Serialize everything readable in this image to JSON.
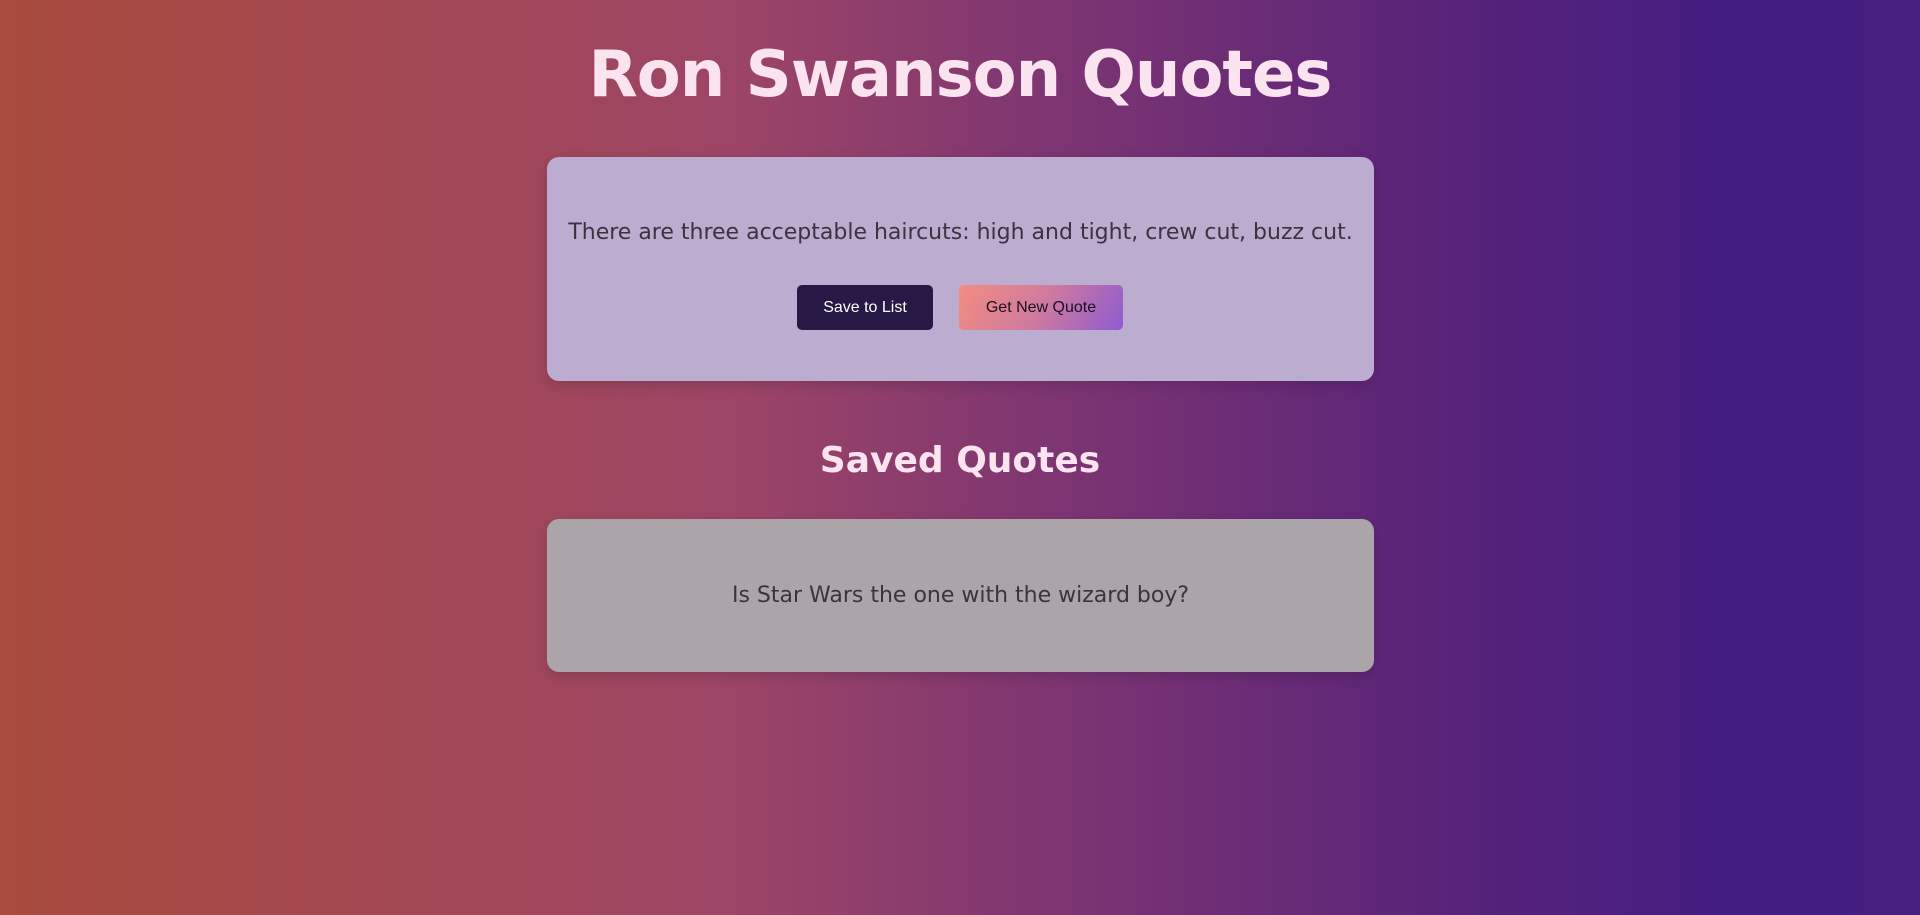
{
  "header": {
    "title": "Ron Swanson Quotes"
  },
  "current_quote": {
    "text": "There are three acceptable haircuts: high and tight, crew cut, buzz cut.",
    "save_label": "Save to List",
    "new_label": "Get New Quote"
  },
  "saved": {
    "title": "Saved Quotes",
    "items": [
      {
        "text": "Is Star Wars the one with the wizard boy?"
      }
    ]
  }
}
